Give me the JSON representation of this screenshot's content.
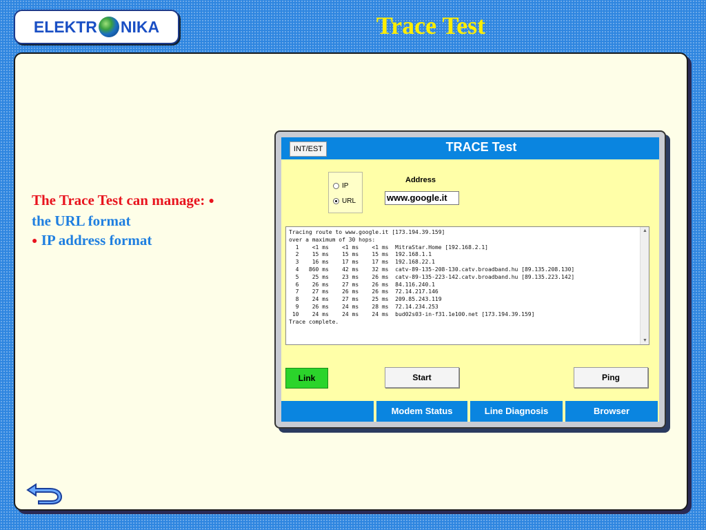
{
  "logo": {
    "left": "ELEKTR",
    "right": "NIKA"
  },
  "page_title": "Trace Test",
  "description": {
    "intro": "The Trace Test can manage:",
    "bullet": "●",
    "item1": "the URL format",
    "item2": "IP address format"
  },
  "app": {
    "int_est_label": "INT/EST",
    "title": "TRACE  Test",
    "radio_ip": "IP",
    "radio_url": "URL",
    "address_label": "Address",
    "address_value": "www.google.it",
    "output": "Tracing route to www.google.it [173.194.39.159]\nover a maximum of 30 hops:\n  1    <1 ms    <1 ms    <1 ms  MitraStar.Home [192.168.2.1]\n  2    15 ms    15 ms    15 ms  192.168.1.1\n  3    16 ms    17 ms    17 ms  192.168.22.1\n  4   860 ms    42 ms    32 ms  catv-89-135-208-130.catv.broadband.hu [89.135.208.130]\n  5    25 ms    23 ms    26 ms  catv-89-135-223-142.catv.broadband.hu [89.135.223.142]\n  6    26 ms    27 ms    26 ms  84.116.240.1\n  7    27 ms    26 ms    26 ms  72.14.217.146\n  8    24 ms    27 ms    25 ms  209.85.243.119\n  9    26 ms    24 ms    28 ms  72.14.234.253\n 10    24 ms    24 ms    24 ms  bud02s03-in-f31.1e100.net [173.194.39.159]\nTrace complete.",
    "link_label": "Link",
    "start_label": "Start",
    "ping_label": "Ping",
    "tabs": [
      "Modem Status",
      "Line Diagnosis",
      "Browser"
    ]
  },
  "icons": {
    "logo_globe": "globe-icon",
    "back": "back-arrow-icon",
    "scroll_up": "scroll-up-icon",
    "scroll_down": "scroll-down-icon"
  },
  "colors": {
    "background": "#2f86e0",
    "title": "#ffee00",
    "app_bar": "#0a85e0",
    "app_body": "#ffffa8",
    "link_active": "#2bd42b"
  }
}
